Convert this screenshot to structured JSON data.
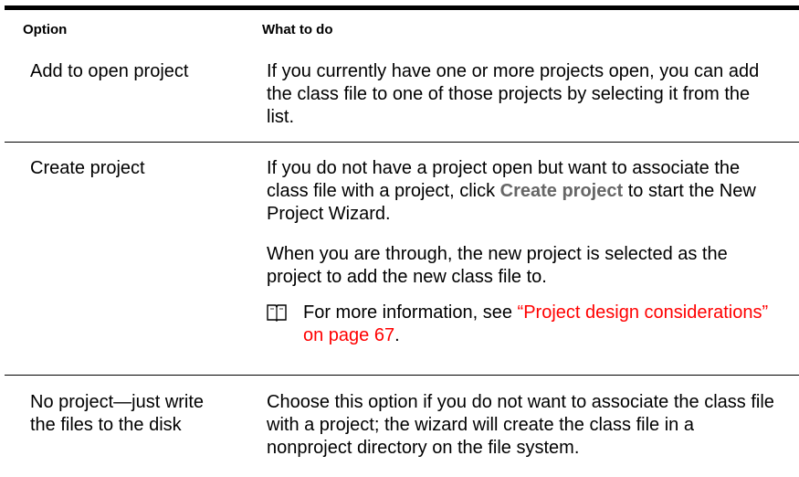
{
  "table": {
    "headers": {
      "option": "Option",
      "what_to_do": "What to do"
    },
    "rows": [
      {
        "option": "Add to open project",
        "desc": "If you currently have one or more projects open, you can add the class file to one of those projects by selecting it from the list."
      },
      {
        "option": "Create project",
        "desc_pre": "If you do not have a project open but want to associate the class file with a project, click",
        "desc_bold": "Create project",
        "desc_post": "to start the New Project Wizard.",
        "desc2": "When you are through, the new project is selected as the project to add the new class file to.",
        "note_text": "For more information, see",
        "note_link": "“Project design considerations” on page 67",
        "note_end": "."
      },
      {
        "option": "No project—just write the files to the disk",
        "desc": "Choose this option if you do not want to associate the class file with a project; the wizard will create the class file in a nonproject directory on the file system."
      }
    ]
  },
  "icons": {
    "note": "book-icon"
  }
}
